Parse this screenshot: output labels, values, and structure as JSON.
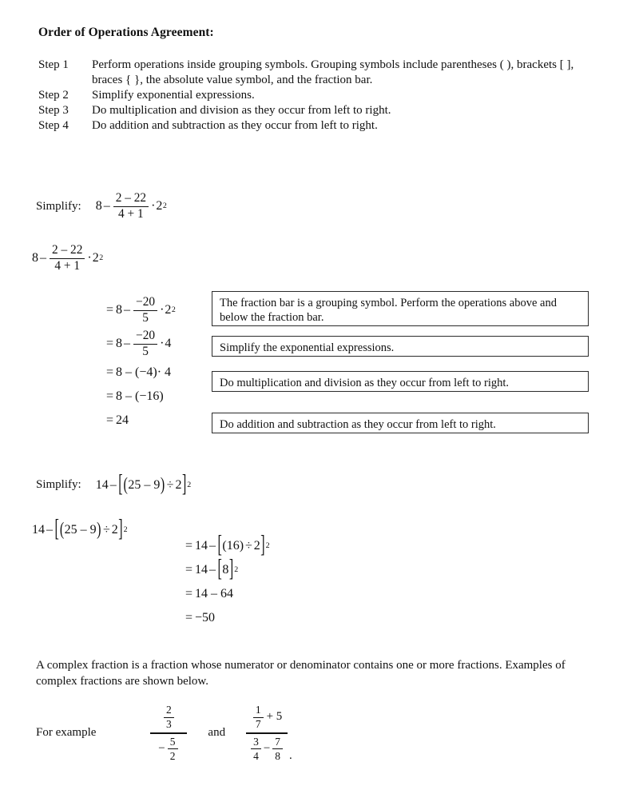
{
  "document": {
    "title": "Order of Operations Agreement:"
  },
  "steps": [
    {
      "label": "Step 1",
      "text": "Perform operations inside grouping symbols.  Grouping symbols include parentheses ( ), brackets [ ], braces { }, the absolute value symbol, and the fraction bar."
    },
    {
      "label": "Step 2",
      "text": "Simplify exponential expressions."
    },
    {
      "label": "Step 3",
      "text": "Do multiplication and division as they occur from left to right."
    },
    {
      "label": "Step 4",
      "text": "Do addition and subtraction as they occur from left to right."
    }
  ],
  "example_one": {
    "prompt_label": "Simplify:",
    "expression": {
      "lead": "8",
      "minus": "–",
      "fraction": {
        "numerator": "2 – 22",
        "denominator": "4 + 1"
      },
      "dot": "·",
      "base": "2",
      "exponent": "2"
    },
    "solution_steps": [
      {
        "equals": "=",
        "lead": "8",
        "minus": "–",
        "fraction": {
          "numerator": "−20",
          "denominator": "5"
        },
        "dot": "·",
        "base": "2",
        "exponent": "2"
      },
      {
        "equals": "=",
        "lead": "8",
        "minus": "–",
        "fraction": {
          "numerator": "−20",
          "denominator": "5"
        },
        "dot": "·",
        "tail": "4"
      },
      {
        "equals": "=",
        "text": "8 – (−4)· 4"
      },
      {
        "equals": "=",
        "text": "8 – (−16)"
      },
      {
        "equals": "=",
        "text": "24"
      }
    ],
    "callouts": [
      "The fraction bar is a grouping symbol.  Perform the operations above and below the fraction bar.",
      "Simplify the exponential expressions.",
      "Do multiplication and division as they occur from left to right.",
      "Do addition and subtraction as they occur from left to right."
    ]
  },
  "example_two": {
    "prompt_label": "Simplify:",
    "expression": {
      "lead": "14",
      "minus": "–",
      "open_bracket": "[",
      "open_paren": "(",
      "inner": "25 – 9",
      "close_paren": ")",
      "divide": "÷",
      "divisor": "2",
      "close_bracket": "]",
      "exponent": "2"
    },
    "solution_steps": [
      {
        "equals": "=",
        "lead": "14",
        "minus": "–",
        "open_bracket": "[",
        "inner": "(16)",
        "divide": "÷",
        "divisor": "2",
        "close_bracket": "]",
        "exponent": "2"
      },
      {
        "equals": "=",
        "lead": "14",
        "minus": "–",
        "open_bracket": "[",
        "inner": "8",
        "close_bracket": "]",
        "exponent": "2"
      },
      {
        "equals": "=",
        "text": "14 – 64"
      },
      {
        "equals": "=",
        "text": "−50"
      }
    ]
  },
  "complex_fraction": {
    "paragraph": "A complex fraction is a fraction whose numerator or denominator contains one or more fractions.  Examples of complex fractions are shown below.",
    "intro": "For example",
    "conjunction": "and",
    "first": {
      "numerator": {
        "top": "2",
        "bottom": "3"
      },
      "denominator": {
        "sign": "−",
        "top": "5",
        "bottom": "2"
      }
    },
    "second": {
      "numerator": {
        "top": "1",
        "bottom": "7",
        "addend": "+ 5"
      },
      "denominator": {
        "left": {
          "top": "3",
          "bottom": "4"
        },
        "operator": "−",
        "right": {
          "top": "7",
          "bottom": "8"
        }
      },
      "trailing": "."
    }
  }
}
